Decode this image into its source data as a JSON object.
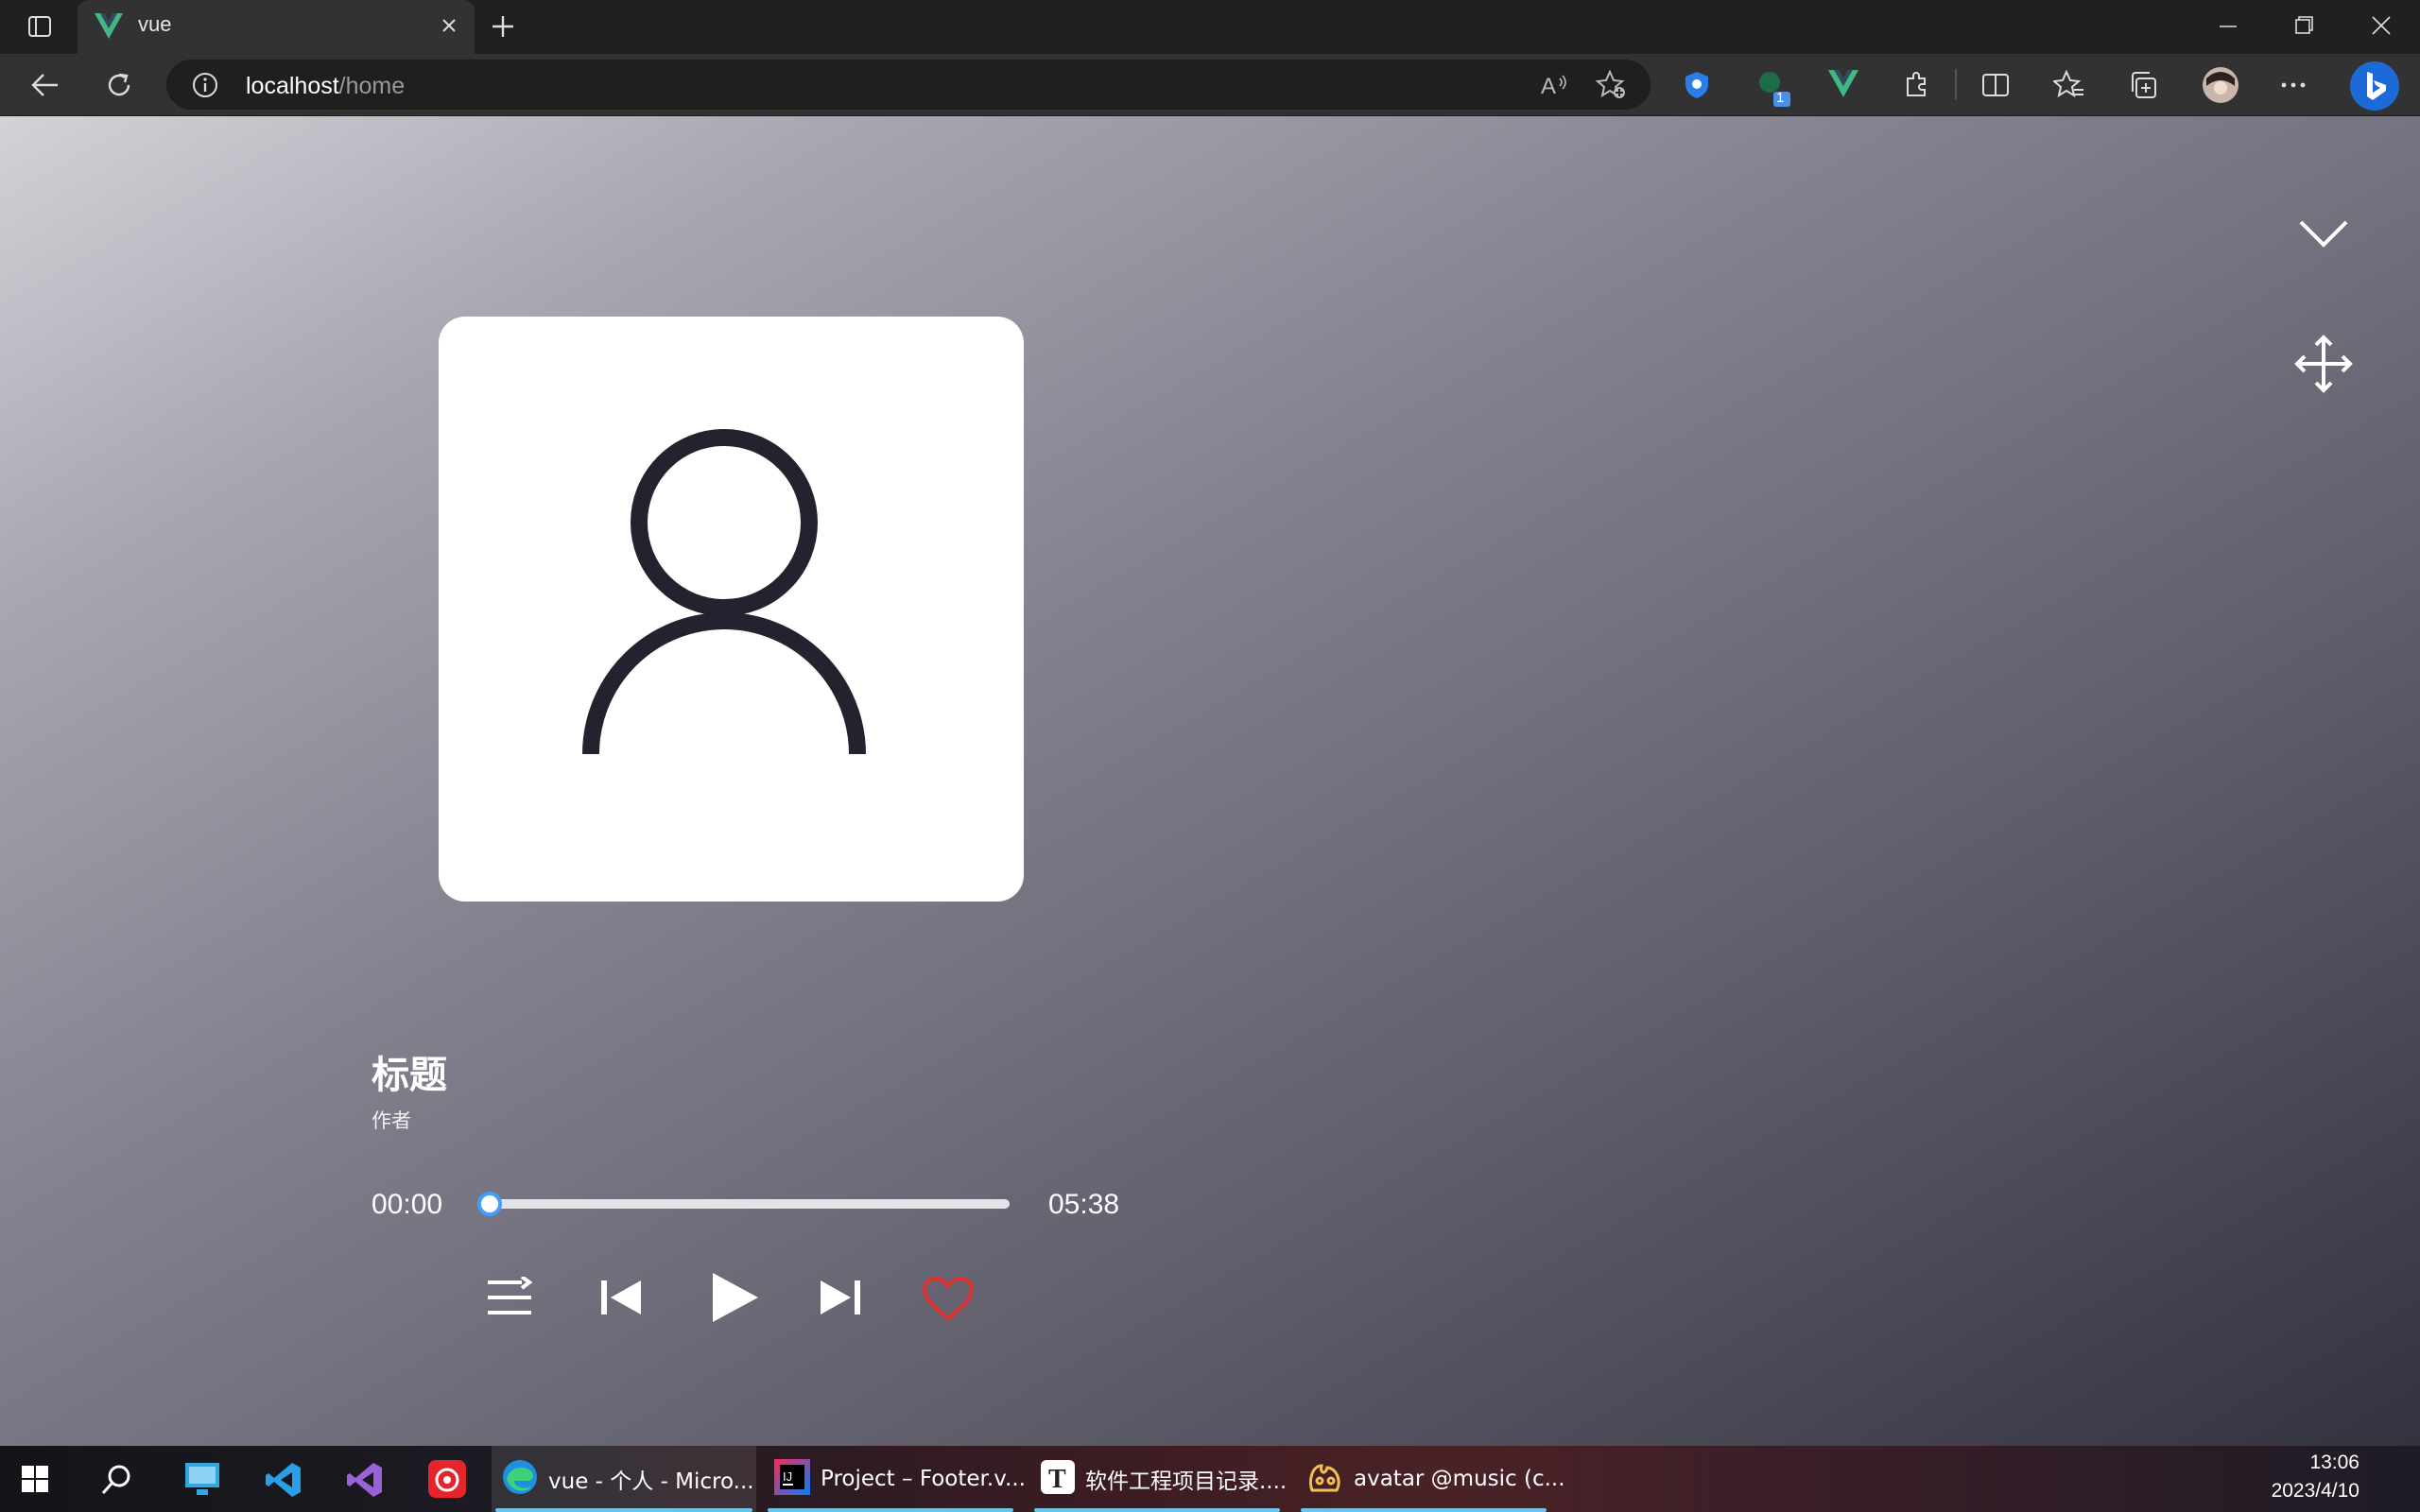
{
  "browser": {
    "tab_title": "vue",
    "url_host": "localhost",
    "url_path": "/home",
    "extension_badge": "1"
  },
  "player": {
    "title": "标题",
    "author": "作者",
    "current_time": "00:00",
    "total_time": "05:38",
    "progress": 0,
    "liked": false,
    "accent_color": "#409eff",
    "like_color": "#e03131"
  },
  "taskbar": {
    "apps": [
      {
        "label": "vue - 个人 - Micro...",
        "icon": "edge-icon"
      },
      {
        "label": "Project – Footer.v...",
        "icon": "intellij-icon"
      },
      {
        "label": "软件工程项目记录....",
        "icon": "typora-icon"
      },
      {
        "label": "avatar @music (c...",
        "icon": "navicat-icon"
      }
    ],
    "time": "13:06",
    "date": "2023/4/10"
  }
}
